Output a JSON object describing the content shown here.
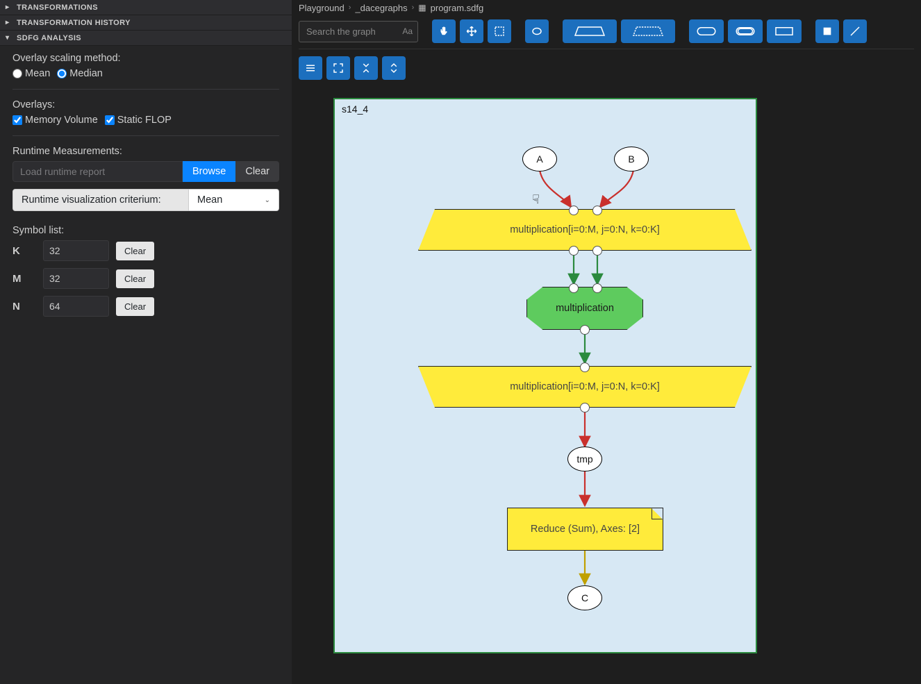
{
  "sidebar": {
    "sections": {
      "transformations": {
        "title": "TRANSFORMATIONS"
      },
      "history": {
        "title": "TRANSFORMATION HISTORY"
      },
      "analysis": {
        "title": "SDFG ANALYSIS"
      }
    },
    "analysis": {
      "scaling_label": "Overlay scaling method:",
      "scaling_options": [
        "Mean",
        "Median"
      ],
      "scaling_selected": "Median",
      "overlays_label": "Overlays:",
      "overlays": [
        {
          "label": "Memory Volume",
          "checked": true
        },
        {
          "label": "Static FLOP",
          "checked": true
        }
      ],
      "runtime_label": "Runtime Measurements:",
      "runtime_placeholder": "Load runtime report",
      "browse_label": "Browse",
      "clear_label": "Clear",
      "criterium_label": "Runtime visualization criterium:",
      "criterium_selected": "Mean",
      "symbol_list_label": "Symbol list:",
      "symbols": [
        {
          "name": "K",
          "value": "32"
        },
        {
          "name": "M",
          "value": "32"
        },
        {
          "name": "N",
          "value": "64"
        }
      ],
      "symbol_clear_label": "Clear"
    }
  },
  "breadcrumb": [
    {
      "label": "Playground"
    },
    {
      "label": "_dacegraphs"
    },
    {
      "label": "program.sdfg",
      "icon": "file"
    }
  ],
  "search": {
    "placeholder": "Search the graph",
    "case_badge": "Aa"
  },
  "canvas": {
    "frame_title": "s14_4",
    "nodes": {
      "A": {
        "label": "A"
      },
      "B": {
        "label": "B"
      },
      "map_entry": {
        "label": "multiplication[i=0:M, j=0:N, k=0:K]"
      },
      "task": {
        "label": "multiplication"
      },
      "map_exit": {
        "label": "multiplication[i=0:M, j=0:N, k=0:K]"
      },
      "tmp": {
        "label": "tmp"
      },
      "reduce": {
        "label": "Reduce (Sum), Axes: [2]"
      },
      "C": {
        "label": "C"
      }
    }
  }
}
